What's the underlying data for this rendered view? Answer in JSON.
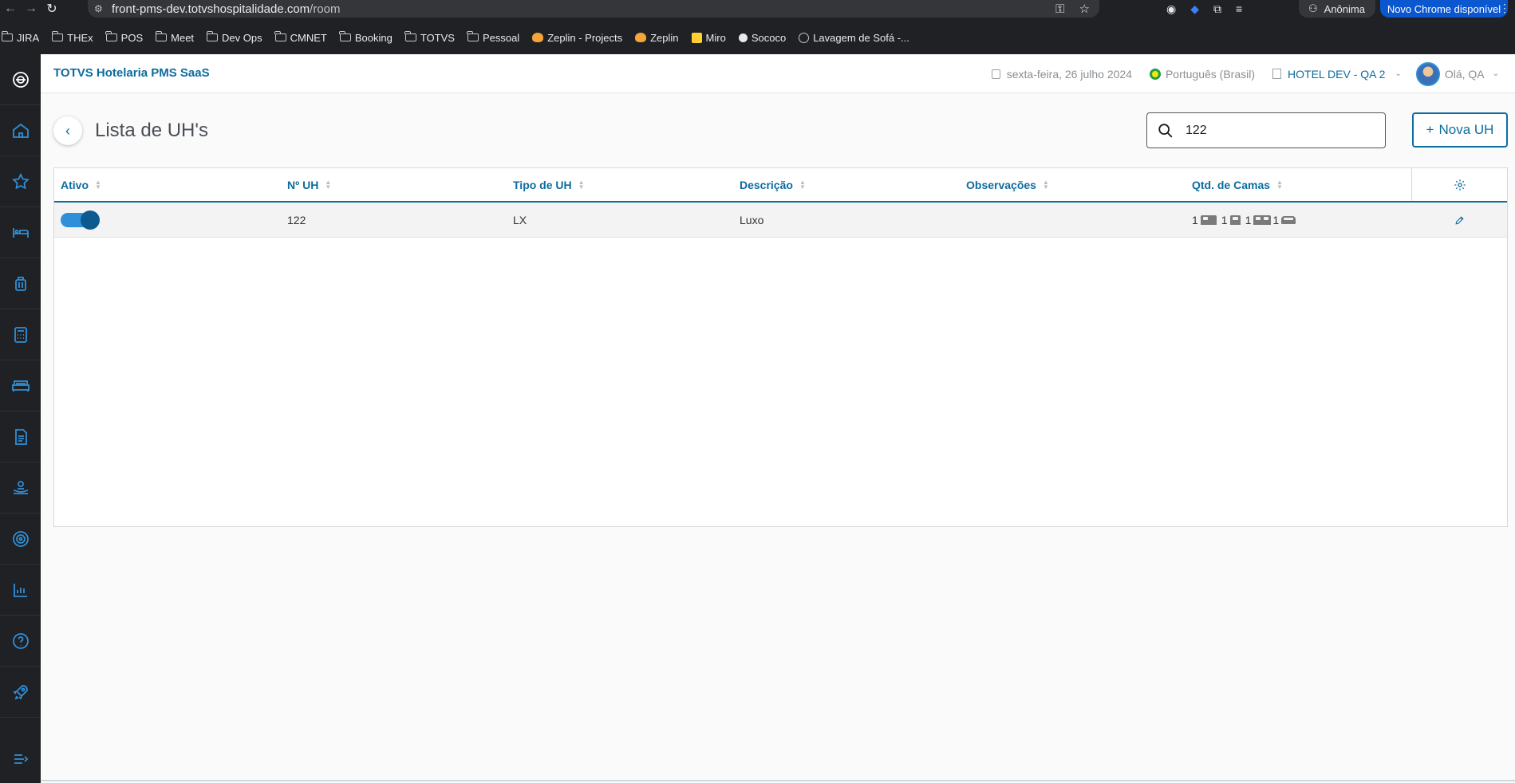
{
  "browser": {
    "url_host": "front-pms-dev.totvshospitalidade.com",
    "url_path": "/room",
    "profile_label": "Anônima",
    "update_label": "Novo Chrome disponível",
    "bookmarks": [
      {
        "label": "JIRA",
        "icon": "folder-icon"
      },
      {
        "label": "THEx",
        "icon": "folder-icon"
      },
      {
        "label": "POS",
        "icon": "folder-icon"
      },
      {
        "label": "Meet",
        "icon": "folder-icon"
      },
      {
        "label": "Dev Ops",
        "icon": "folder-icon"
      },
      {
        "label": "CMNET",
        "icon": "folder-icon"
      },
      {
        "label": "Booking",
        "icon": "folder-icon"
      },
      {
        "label": "TOTVS",
        "icon": "folder-icon"
      },
      {
        "label": "Pessoal",
        "icon": "folder-icon"
      },
      {
        "label": "Zeplin - Projects",
        "icon": "zeplin-icon"
      },
      {
        "label": "Zeplin",
        "icon": "zeplin-icon"
      },
      {
        "label": "Miro",
        "icon": "miro-icon"
      },
      {
        "label": "Sococo",
        "icon": "sococo-icon"
      },
      {
        "label": "Lavagem de Sofá -...",
        "icon": "globe-icon"
      }
    ]
  },
  "app": {
    "title": "TOTVS Hotelaria PMS SaaS",
    "date": "sexta-feira, 26 julho 2024",
    "language": "Português (Brasil)",
    "hotel": "HOTEL DEV - QA 2",
    "greeting": "Olá, QA"
  },
  "sidebar": {
    "items": [
      {
        "icon": "home-icon"
      },
      {
        "icon": "star-icon"
      },
      {
        "icon": "bed-icon"
      },
      {
        "icon": "luggage-icon"
      },
      {
        "icon": "calculator-icon"
      },
      {
        "icon": "double-bed-icon"
      },
      {
        "icon": "document-icon"
      },
      {
        "icon": "hand-service-icon"
      },
      {
        "icon": "target-icon"
      },
      {
        "icon": "chart-icon"
      },
      {
        "icon": "help-icon"
      },
      {
        "icon": "rocket-icon"
      },
      {
        "icon": "collapse-menu-icon"
      }
    ]
  },
  "page": {
    "title": "Lista de UH's",
    "search_value": "122",
    "new_button": "Nova UH",
    "new_button_icon": "+"
  },
  "table": {
    "columns": [
      "Ativo",
      "Nº UH",
      "Tipo de UH",
      "Descrição",
      "Observações",
      "Qtd. de Camas"
    ],
    "rows": [
      {
        "active": true,
        "number": "122",
        "type": "LX",
        "description": "Luxo",
        "observations": "",
        "beds": [
          {
            "count": "1",
            "icon": "double-bed-icon"
          },
          {
            "count": "1",
            "icon": "single-bed-icon"
          },
          {
            "count": "1",
            "icon": "twin-bed-icon"
          },
          {
            "count": "1",
            "icon": "sofa-bed-icon"
          }
        ]
      }
    ]
  },
  "colors": {
    "accent": "#0c6c9f",
    "sidebar_bg": "#202124",
    "sidebar_icon": "#2f8fd8",
    "toggle_on": "#2f8fd8"
  }
}
